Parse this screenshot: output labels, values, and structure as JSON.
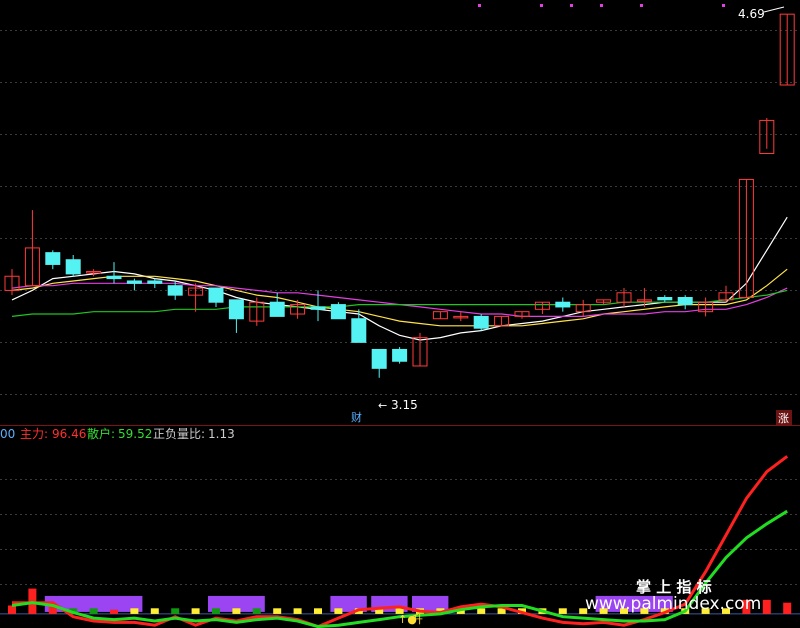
{
  "chart_data": [
    {
      "type": "candlestick",
      "ylim": [
        2.95,
        4.75
      ],
      "candles": [
        {
          "o": 3.52,
          "h": 3.61,
          "l": 3.5,
          "c": 3.58
        },
        {
          "o": 3.54,
          "h": 3.86,
          "l": 3.54,
          "c": 3.7
        },
        {
          "o": 3.68,
          "h": 3.69,
          "l": 3.61,
          "c": 3.63
        },
        {
          "o": 3.65,
          "h": 3.67,
          "l": 3.58,
          "c": 3.59
        },
        {
          "o": 3.6,
          "h": 3.61,
          "l": 3.58,
          "c": 3.6
        },
        {
          "o": 3.58,
          "h": 3.64,
          "l": 3.55,
          "c": 3.57
        },
        {
          "o": 3.56,
          "h": 3.57,
          "l": 3.52,
          "c": 3.55
        },
        {
          "o": 3.56,
          "h": 3.57,
          "l": 3.53,
          "c": 3.55
        },
        {
          "o": 3.54,
          "h": 3.56,
          "l": 3.48,
          "c": 3.5
        },
        {
          "o": 3.5,
          "h": 3.55,
          "l": 3.43,
          "c": 3.53
        },
        {
          "o": 3.53,
          "h": 3.53,
          "l": 3.45,
          "c": 3.47
        },
        {
          "o": 3.48,
          "h": 3.48,
          "l": 3.34,
          "c": 3.4
        },
        {
          "o": 3.39,
          "h": 3.49,
          "l": 3.37,
          "c": 3.47
        },
        {
          "o": 3.47,
          "h": 3.51,
          "l": 3.41,
          "c": 3.41
        },
        {
          "o": 3.42,
          "h": 3.48,
          "l": 3.4,
          "c": 3.46
        },
        {
          "o": 3.45,
          "h": 3.52,
          "l": 3.39,
          "c": 3.44
        },
        {
          "o": 3.46,
          "h": 3.47,
          "l": 3.4,
          "c": 3.4
        },
        {
          "o": 3.4,
          "h": 3.44,
          "l": 3.3,
          "c": 3.3
        },
        {
          "o": 3.27,
          "h": 3.27,
          "l": 3.15,
          "c": 3.19
        },
        {
          "o": 3.27,
          "h": 3.28,
          "l": 3.21,
          "c": 3.22
        },
        {
          "o": 3.2,
          "h": 3.34,
          "l": 3.2,
          "c": 3.32
        },
        {
          "o": 3.4,
          "h": 3.43,
          "l": 3.4,
          "c": 3.43
        },
        {
          "o": 3.41,
          "h": 3.43,
          "l": 3.39,
          "c": 3.41
        },
        {
          "o": 3.41,
          "h": 3.42,
          "l": 3.35,
          "c": 3.36
        },
        {
          "o": 3.37,
          "h": 3.41,
          "l": 3.37,
          "c": 3.41
        },
        {
          "o": 3.41,
          "h": 3.43,
          "l": 3.4,
          "c": 3.43
        },
        {
          "o": 3.44,
          "h": 3.47,
          "l": 3.42,
          "c": 3.47
        },
        {
          "o": 3.47,
          "h": 3.49,
          "l": 3.43,
          "c": 3.45
        },
        {
          "o": 3.43,
          "h": 3.48,
          "l": 3.41,
          "c": 3.46
        },
        {
          "o": 3.47,
          "h": 3.48,
          "l": 3.46,
          "c": 3.48
        },
        {
          "o": 3.47,
          "h": 3.53,
          "l": 3.45,
          "c": 3.51
        },
        {
          "o": 3.48,
          "h": 3.53,
          "l": 3.45,
          "c": 3.48
        },
        {
          "o": 3.49,
          "h": 3.5,
          "l": 3.47,
          "c": 3.48
        },
        {
          "o": 3.49,
          "h": 3.5,
          "l": 3.44,
          "c": 3.46
        },
        {
          "o": 3.43,
          "h": 3.49,
          "l": 3.41,
          "c": 3.47
        },
        {
          "o": 3.48,
          "h": 3.54,
          "l": 3.47,
          "c": 3.51
        },
        {
          "o": 3.49,
          "h": 3.99,
          "l": 3.49,
          "c": 3.99
        },
        {
          "o": 4.1,
          "h": 4.25,
          "l": 4.12,
          "c": 4.24
        },
        {
          "o": 4.39,
          "h": 4.69,
          "l": 4.39,
          "c": 4.69
        }
      ],
      "ma": [
        {
          "color": "#ffffff",
          "values": [
            3.48,
            3.52,
            3.57,
            3.58,
            3.59,
            3.6,
            3.59,
            3.57,
            3.56,
            3.54,
            3.52,
            3.49,
            3.47,
            3.46,
            3.45,
            3.44,
            3.43,
            3.42,
            3.37,
            3.33,
            3.31,
            3.32,
            3.34,
            3.35,
            3.37,
            3.38,
            3.39,
            3.41,
            3.43,
            3.44,
            3.45,
            3.46,
            3.47,
            3.47,
            3.47,
            3.47,
            3.55,
            3.69,
            3.83
          ]
        },
        {
          "color": "#ffe24a",
          "values": [
            3.52,
            3.53,
            3.55,
            3.56,
            3.57,
            3.58,
            3.58,
            3.58,
            3.57,
            3.56,
            3.54,
            3.52,
            3.5,
            3.49,
            3.47,
            3.45,
            3.44,
            3.43,
            3.41,
            3.39,
            3.38,
            3.37,
            3.37,
            3.37,
            3.37,
            3.37,
            3.38,
            3.39,
            3.4,
            3.42,
            3.43,
            3.44,
            3.45,
            3.46,
            3.46,
            3.46,
            3.48,
            3.54,
            3.61
          ]
        },
        {
          "color": "#e33fe3",
          "values": [
            3.53,
            3.54,
            3.54,
            3.55,
            3.55,
            3.55,
            3.55,
            3.55,
            3.55,
            3.54,
            3.54,
            3.53,
            3.52,
            3.51,
            3.51,
            3.5,
            3.49,
            3.48,
            3.47,
            3.46,
            3.45,
            3.44,
            3.43,
            3.42,
            3.42,
            3.41,
            3.41,
            3.41,
            3.41,
            3.42,
            3.42,
            3.42,
            3.43,
            3.43,
            3.44,
            3.44,
            3.46,
            3.49,
            3.53
          ]
        },
        {
          "color": "#21c421",
          "values": [
            3.41,
            3.42,
            3.42,
            3.42,
            3.43,
            3.43,
            3.43,
            3.43,
            3.44,
            3.44,
            3.44,
            3.45,
            3.45,
            3.45,
            3.45,
            3.45,
            3.45,
            3.46,
            3.46,
            3.46,
            3.46,
            3.46,
            3.46,
            3.46,
            3.46,
            3.46,
            3.46,
            3.46,
            3.46,
            3.46,
            3.47,
            3.47,
            3.47,
            3.47,
            3.47,
            3.48,
            3.49,
            3.5,
            3.52
          ]
        }
      ],
      "annotations": {
        "high": "4.69",
        "low": "3.15",
        "cai": "财",
        "zhang": "涨"
      }
    },
    {
      "type": "line+bar",
      "ylim": [
        -10,
        120
      ],
      "legend": {
        "lead": "00",
        "zhuli_label": "主力:",
        "zhuli": "96.46",
        "sanhu_label": "散户:",
        "sanhu": "59.52",
        "ratio_label": "正负量比:",
        "ratio": "1.13"
      },
      "zhuli_series": [
        8,
        8,
        8,
        -2,
        -5,
        -6,
        -6,
        -8,
        -2,
        -8,
        -3,
        -5,
        -2,
        -2,
        -4,
        -9,
        -3,
        3,
        4,
        5,
        2,
        1,
        5,
        7,
        5,
        1,
        -3,
        -6,
        -7,
        -6,
        -8,
        -4,
        1,
        7,
        30,
        56,
        82,
        101,
        112
      ],
      "sanhu_series": [
        6,
        8,
        6,
        1,
        -3,
        -4,
        -3,
        -5,
        -3,
        -5,
        -4,
        -6,
        -4,
        -3,
        -5,
        -9,
        -8,
        -6,
        -4,
        -2,
        -1,
        0,
        3,
        5,
        6,
        6,
        2,
        -2,
        -3,
        -4,
        -5,
        -5,
        -4,
        2,
        22,
        40,
        54,
        64,
        73
      ],
      "bars": [
        {
          "c": "r",
          "h": 6
        },
        {
          "c": "r",
          "h": 18
        },
        {
          "c": "r",
          "h": 6
        },
        {
          "c": "g",
          "h": 4
        },
        {
          "c": "g",
          "h": 4
        },
        {
          "c": "r",
          "h": 3
        },
        {
          "c": "y",
          "h": 4
        },
        {
          "c": "y",
          "h": 4
        },
        {
          "c": "g",
          "h": 4
        },
        {
          "c": "y",
          "h": 4
        },
        {
          "c": "g",
          "h": 4
        },
        {
          "c": "y",
          "h": 4
        },
        {
          "c": "g",
          "h": 4
        },
        {
          "c": "y",
          "h": 4
        },
        {
          "c": "y",
          "h": 4
        },
        {
          "c": "y",
          "h": 4
        },
        {
          "c": "y",
          "h": 4
        },
        {
          "c": "y",
          "h": 4
        },
        {
          "c": "y",
          "h": 4
        },
        {
          "c": "y",
          "h": 4
        },
        {
          "c": "y",
          "h": 4
        },
        {
          "c": "y",
          "h": 4
        },
        {
          "c": "y",
          "h": 4
        },
        {
          "c": "y",
          "h": 4
        },
        {
          "c": "y",
          "h": 4
        },
        {
          "c": "y",
          "h": 4
        },
        {
          "c": "y",
          "h": 4
        },
        {
          "c": "y",
          "h": 4
        },
        {
          "c": "y",
          "h": 4
        },
        {
          "c": "y",
          "h": 4
        },
        {
          "c": "y",
          "h": 4
        },
        {
          "c": "y",
          "h": 4
        },
        {
          "c": "y",
          "h": 4
        },
        {
          "c": "y",
          "h": 4
        },
        {
          "c": "y",
          "h": 4
        },
        {
          "c": "y",
          "h": 4
        },
        {
          "c": "r",
          "h": 10
        },
        {
          "c": "r",
          "h": 10
        },
        {
          "c": "r",
          "h": 8
        }
      ],
      "purple_bands": [
        [
          2,
          6
        ],
        [
          10,
          12
        ],
        [
          16,
          17
        ],
        [
          18,
          19
        ],
        [
          20,
          21
        ],
        [
          29,
          32
        ]
      ],
      "sheng_label": "升",
      "watermark_cn": "掌 上 指 标",
      "watermark_url": "www.palmindex.com"
    }
  ]
}
